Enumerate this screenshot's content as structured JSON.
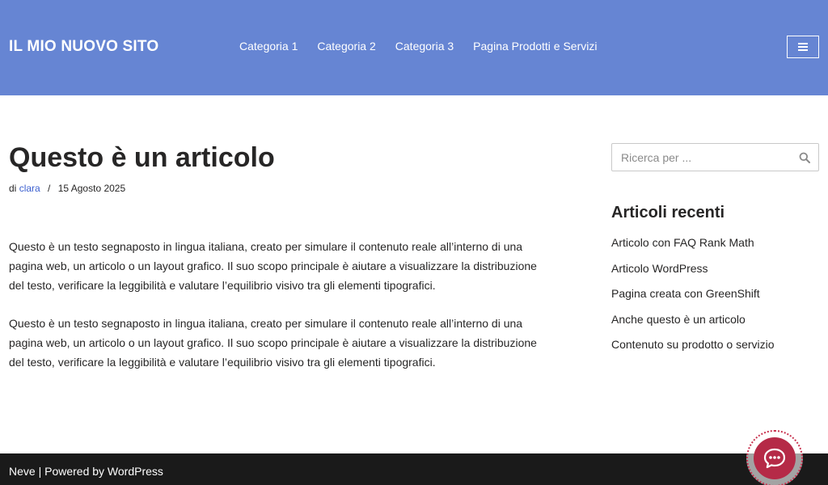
{
  "header": {
    "site_title": "IL MIO NUOVO SITO",
    "nav": [
      "Categoria 1",
      "Categoria 2",
      "Categoria 3",
      "Pagina Prodotti e Servizi"
    ],
    "menu_icon": "hamburger-icon"
  },
  "post": {
    "title": "Questo è un articolo",
    "meta_prefix": "di",
    "author": "clara",
    "separator": "/",
    "date": "15 Agosto 2025",
    "paragraphs": [
      "Questo è un testo segnaposto in lingua italiana, creato per simulare il contenuto reale all’interno di una pagina web, un articolo o un layout grafico. Il suo scopo principale è aiutare a visualizzare la distribuzione del testo, verificare la leggibilità e valutare l’equilibrio visivo tra gli elementi tipografici.",
      "Questo è un testo segnaposto in lingua italiana, creato per simulare il contenuto reale all’interno di una pagina web, un articolo o un layout grafico. Il suo scopo principale è aiutare a visualizzare la distribuzione del testo, verificare la leggibilità e valutare l’equilibrio visivo tra gli elementi tipografici."
    ]
  },
  "sidebar": {
    "search_placeholder": "Ricerca per ...",
    "search_icon": "search-icon",
    "recent_title": "Articoli recenti",
    "recent_posts": [
      "Articolo con FAQ Rank Math",
      "Articolo WordPress",
      "Pagina creata con GreenShift",
      "Anche questo è un articolo",
      "Contenuto su prodotto o servizio"
    ]
  },
  "footer": {
    "theme": "Neve",
    "separator": " | ",
    "powered_by": "Powered by WordPress"
  },
  "chat": {
    "icon": "chat-bubble-icon"
  },
  "colors": {
    "header_bg": "#6685d3",
    "footer_bg": "#1a1a1a",
    "link": "#3b5fcf",
    "chat_accent": "#b52a47"
  }
}
